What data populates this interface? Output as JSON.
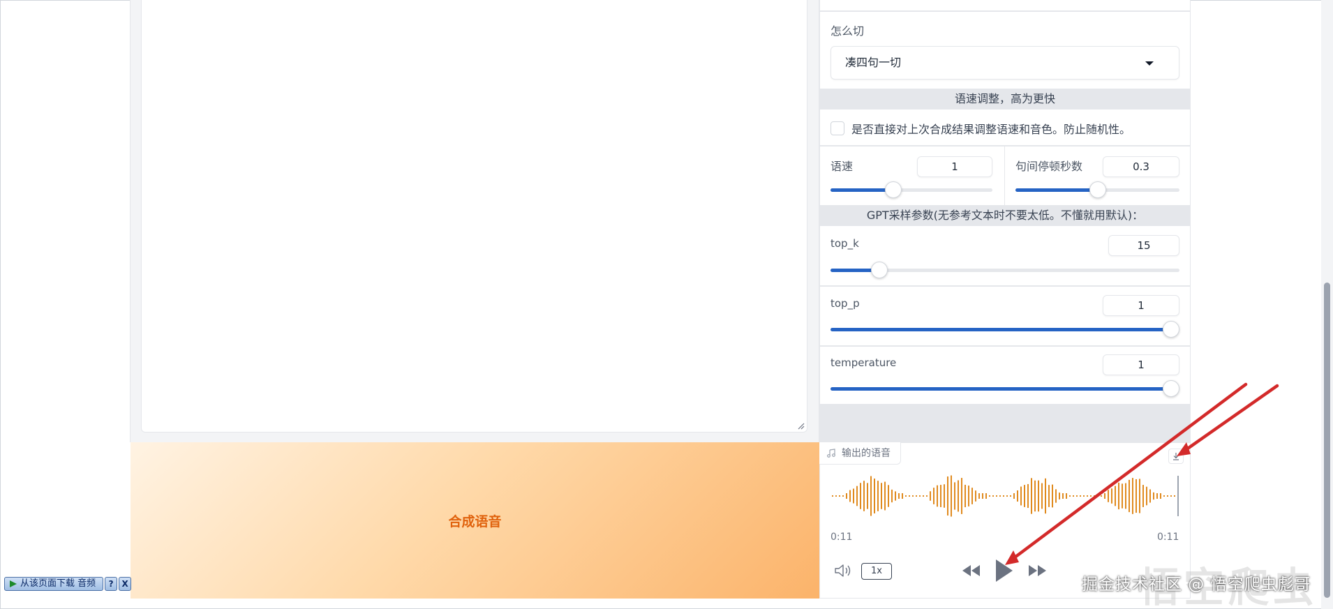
{
  "split": {
    "label": "怎么切",
    "selected": "凑四句一切"
  },
  "speed_section": {
    "title": "语速调整，高为更快",
    "checkbox_label": "是否直接对上次合成结果调整语速和音色。防止随机性。",
    "checkbox_checked": false
  },
  "speed": {
    "label": "语速",
    "value": "1",
    "fraction": 0.39
  },
  "pause": {
    "label": "句间停顿秒数",
    "value": "0.3",
    "fraction": 0.5
  },
  "gpt_section": {
    "title": "GPT采样参数(无参考文本时不要太低。不懂就用默认)："
  },
  "top_k": {
    "label": "top_k",
    "value": "15",
    "fraction": 0.14
  },
  "top_p": {
    "label": "top_p",
    "value": "1",
    "fraction": 1.0
  },
  "temperature": {
    "label": "temperature",
    "value": "1",
    "fraction": 1.0
  },
  "generate_button": {
    "label": "合成语音"
  },
  "audio": {
    "label": "输出的语音",
    "current_time": "0:11",
    "duration": "0:11",
    "playback_rate": "1x",
    "waveform_color": "#e08a1e"
  },
  "plugin": {
    "download_label": "从该页面下载 音频",
    "help_label": "?",
    "close_label": "X"
  },
  "watermark": {
    "text": "掘金技术社区 @ 悟空爬虫彪哥",
    "bg_text": "悟空爬虫"
  },
  "colors": {
    "accent": "#2563c4",
    "button_text": "#e0620d",
    "arrow": "#d32a2a"
  }
}
